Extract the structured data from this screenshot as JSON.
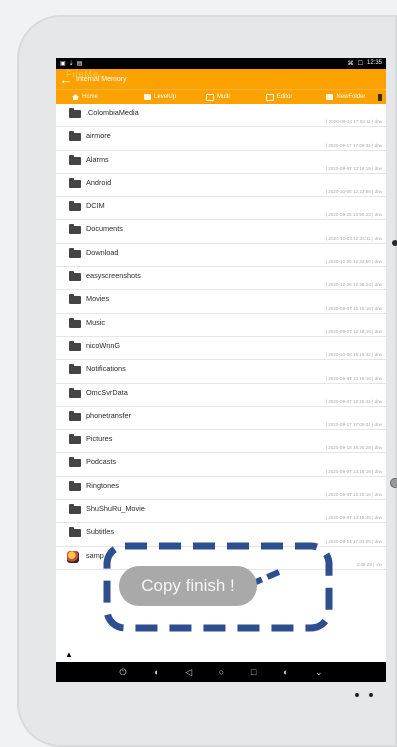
{
  "status": {
    "left_icons": [
      "▣",
      "⇣",
      "▤"
    ],
    "right_text": "12:35",
    "right_icons": [
      "⌘",
      "☐"
    ]
  },
  "appbar": {
    "title": "Internal Memory",
    "ghost_text": "FileMe…"
  },
  "toolbar": [
    {
      "label": "Home",
      "icon": "home-icon"
    },
    {
      "label": "LevelUp",
      "icon": "level-up-icon"
    },
    {
      "label": "Multi",
      "icon": "multi-icon"
    },
    {
      "label": "Editor",
      "icon": "editor-icon"
    },
    {
      "label": "NewFolder",
      "icon": "new-folder-icon"
    }
  ],
  "files": [
    {
      "name": ".ColombiaMedia",
      "meta": "| 2020-09-24 17:03:11 | drw"
    },
    {
      "name": "airmore",
      "meta": "| 2020-09-17 17:09:31 | drw"
    },
    {
      "name": "Alarms",
      "meta": "| 2020-09-07 13:18:16 | drw"
    },
    {
      "name": "Android",
      "meta": "| 2020-10-05 12:23:55 | drw"
    },
    {
      "name": "DCIM",
      "meta": "| 2020-09-25 13:50:23 | drw"
    },
    {
      "name": "Documents",
      "meta": "| 2020-10-03 12:24:11 | drw"
    },
    {
      "name": "Download",
      "meta": "| 2020-10-05 12:32:50 | drw"
    },
    {
      "name": "easyscreenshots",
      "meta": "| 2020-12-28 12:35:24 | drw"
    },
    {
      "name": "Movies",
      "meta": "| 2020-09-07 13:18:16 | drw"
    },
    {
      "name": "Music",
      "meta": "| 2020-09-07 13:18:16 | drw"
    },
    {
      "name": "nicoWnnG",
      "meta": "| 2020-10-08 15:15:42 | drw"
    },
    {
      "name": "Notifications",
      "meta": "| 2020-09-07 13:18:16 | drw"
    },
    {
      "name": "OmcSvrData",
      "meta": "| 2020-09-07 13:25:41 | drw"
    },
    {
      "name": "phonetransfer",
      "meta": "| 2020-09-17 17:09:31 | drw"
    },
    {
      "name": "Pictures",
      "meta": "| 2020-09-18 15:25:28 | drw"
    },
    {
      "name": "Podcasts",
      "meta": "| 2020-09-07 13:18:16 | drw"
    },
    {
      "name": "Ringtones",
      "meta": "| 2020-09-07 13:18:16 | drw"
    },
    {
      "name": "ShuShuRu_Movie",
      "meta": "| 2020-09-07 13:18:46 | drw"
    },
    {
      "name": "Subtitles",
      "meta": "| 2020-09-24 17:03:05 | drw"
    },
    {
      "name": "samp",
      "meta": "2:35:29 | -rw",
      "file": true
    }
  ],
  "toast": {
    "text": "Copy finish !"
  },
  "navbar": [
    "⏻",
    "◖",
    "◁",
    "○",
    "□",
    "◐",
    "⌄"
  ]
}
